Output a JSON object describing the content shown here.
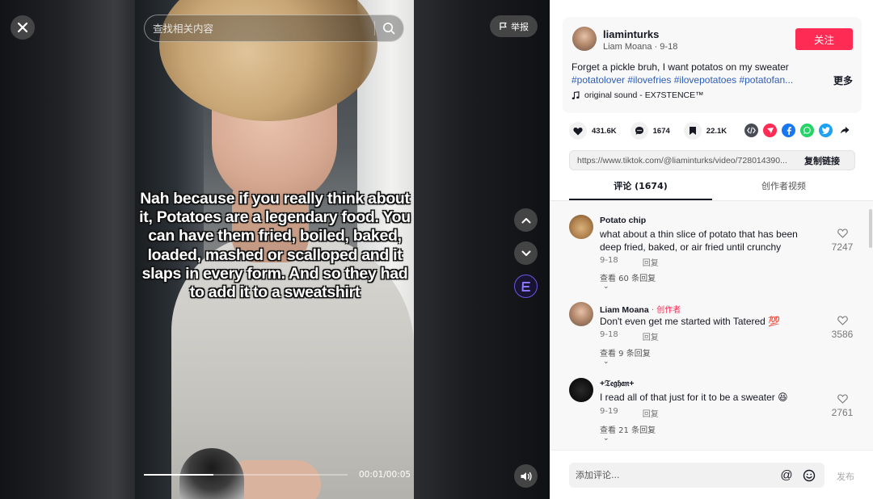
{
  "player": {
    "search_placeholder": "查找相关内容",
    "report_label": "举报",
    "caption": "Nah because if you really think about it, Potatoes are a legendary food. You can have them fried, boiled, baked, loaded, mashed or scalloped and it slaps in every form. And so they had to add it to a sweatshirt",
    "time": "00:01/00:05",
    "progress_fraction": 0.34
  },
  "post": {
    "username": "liaminturks",
    "nickname_date": "Liam Moana · 9-18",
    "follow_label": "关注",
    "description": "Forget a pickle bruh, I want potatos on my sweater",
    "hashtags": "#potatolover #ilovefries #ilovepotatoes #potatofan...",
    "more_label": "更多",
    "sound": "original sound - EX7STENCE™"
  },
  "stats": {
    "likes": "431.6K",
    "comments": "1674",
    "saves": "22.1K"
  },
  "share": {
    "link": "https://www.tiktok.com/@liaminturks/video/728014390...",
    "copy_label": "复制链接"
  },
  "tabs": {
    "comments": "评论 (1674)",
    "creator_videos": "创作者视频"
  },
  "comments": [
    {
      "user": "Potato chip",
      "creator_badge": "",
      "text": "what about a thin slice of potato that has been deep fried, baked, or air fried until crunchy",
      "date": "9-18",
      "reply_label": "回复",
      "likes": "7247",
      "view_replies": "查看 60 条回复"
    },
    {
      "user": "Liam Moana",
      "creator_badge": " · 创作者",
      "text": "Don't even get me started with Tatered 💯",
      "date": "9-18",
      "reply_label": "回复",
      "likes": "3586",
      "view_replies": "查看 9 条回复"
    },
    {
      "user": "+𝔗𝔢𝔤𝔥𝔞𝔫+",
      "creator_badge": "",
      "text": "I read all of that just for it to be a sweater 😆",
      "date": "9-19",
      "reply_label": "回复",
      "likes": "2761",
      "view_replies": "查看 21 条回复"
    }
  ],
  "composer": {
    "placeholder": "添加评论...",
    "post_label": "发布"
  },
  "colors": {
    "accent": "#fe2c55",
    "hashtag": "#2b5db9",
    "effect_ring": "#6a55e0"
  },
  "icons": {
    "close": "close-icon",
    "search": "search-icon",
    "report": "flag-icon",
    "up": "chevron-up-icon",
    "down": "chevron-down-icon",
    "effect": "effect-icon",
    "volume": "volume-icon",
    "music": "music-note-icon",
    "like": "heart-icon",
    "comment": "comment-icon",
    "save": "bookmark-icon",
    "embed": "embed-icon",
    "send": "send-icon",
    "facebook": "facebook-icon",
    "whatsapp": "whatsapp-icon",
    "twitter": "twitter-icon",
    "share": "share-arrow-icon",
    "mention": "mention-icon",
    "emoji": "emoji-icon"
  }
}
